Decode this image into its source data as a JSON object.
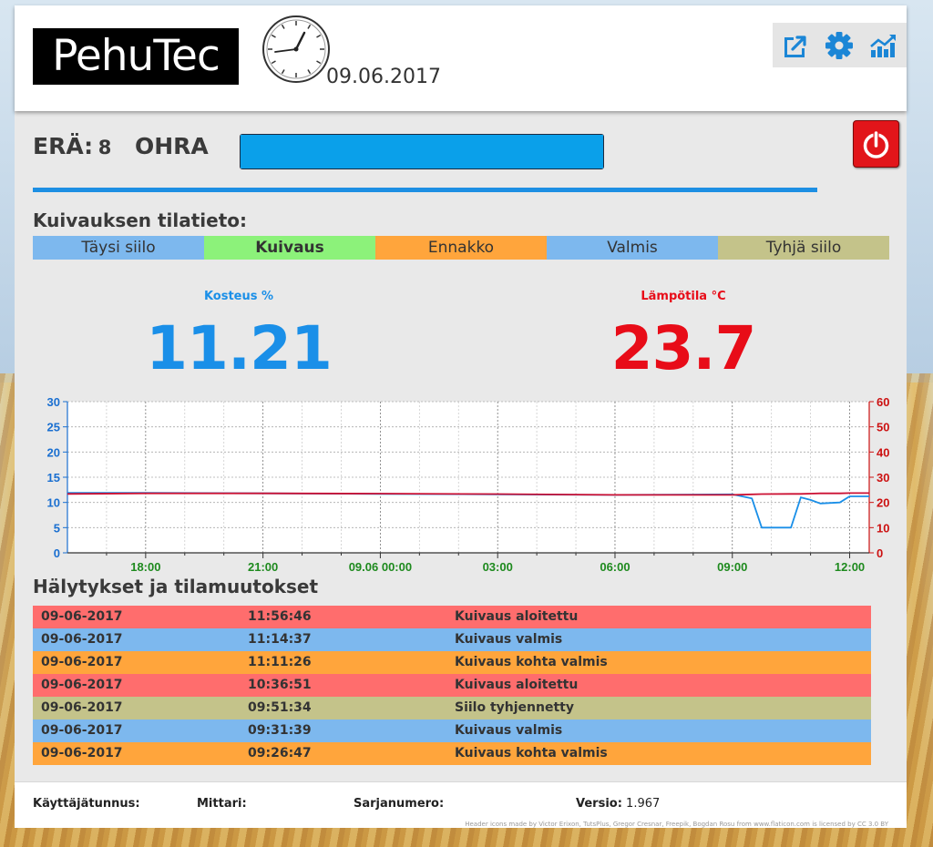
{
  "app": {
    "logo_text": "PehuTec",
    "date": "09.06.2017",
    "toolbar": {
      "icons": [
        "export-icon",
        "gear-icon",
        "chart-trend-icon"
      ]
    }
  },
  "batch": {
    "label": "ERÄ:",
    "number": "8",
    "grain": "OHRA",
    "progress_fraction": 1.0
  },
  "status": {
    "title": "Kuivauksen tilatieto:",
    "states": [
      {
        "label": "Täysi siilo",
        "color": "#7db8ee",
        "active": false
      },
      {
        "label": "Kuivaus",
        "color": "#8cf27a",
        "active": true
      },
      {
        "label": "Ennakko",
        "color": "#ffa53c",
        "active": false
      },
      {
        "label": "Valmis",
        "color": "#7db8ee",
        "active": false
      },
      {
        "label": "Tyhjä siilo",
        "color": "#c4c38a",
        "active": false
      }
    ]
  },
  "gauges": {
    "moisture": {
      "label": "Kosteus %",
      "value": "11.21",
      "color": "#1a8fe8"
    },
    "temperature": {
      "label": "Lämpötila °C",
      "value": "23.7",
      "color": "#e80c18"
    }
  },
  "chart_data": {
    "type": "line",
    "x_ticks": [
      "18:00",
      "21:00",
      "09.06 00:00",
      "03:00",
      "06:00",
      "09:00",
      "12:00"
    ],
    "x": [
      "2017-06-08 16:00",
      "2017-06-08 18:00",
      "2017-06-08 21:00",
      "2017-06-09 00:00",
      "2017-06-09 03:00",
      "2017-06-09 06:00",
      "2017-06-09 09:00",
      "2017-06-09 09:30",
      "2017-06-09 09:45",
      "2017-06-09 10:30",
      "2017-06-09 10:45",
      "2017-06-09 11:00",
      "2017-06-09 11:15",
      "2017-06-09 11:45",
      "2017-06-09 12:00",
      "2017-06-09 12:30"
    ],
    "left_axis": {
      "min": 0,
      "max": 30,
      "ticks": [
        0,
        5,
        10,
        15,
        20,
        25,
        30
      ],
      "color": "#1a6fd0"
    },
    "right_axis": {
      "min": 0,
      "max": 60,
      "ticks": [
        0,
        10,
        20,
        30,
        40,
        50,
        60
      ],
      "color": "#cc1111"
    },
    "series": [
      {
        "axis": "left",
        "color": "#1a8fe8",
        "values": [
          11.9,
          11.9,
          11.8,
          11.7,
          11.6,
          11.5,
          11.6,
          10.8,
          5.0,
          5.0,
          11.0,
          10.5,
          9.8,
          10.0,
          11.2,
          11.2
        ]
      },
      {
        "axis": "right",
        "color": "#cc1133",
        "values": [
          23.4,
          23.6,
          23.6,
          23.5,
          23.3,
          23.0,
          23.0,
          23.2,
          23.3,
          23.4,
          23.4,
          23.5,
          23.6,
          23.6,
          23.7,
          23.7
        ]
      }
    ],
    "grid": true
  },
  "alarms": {
    "title": "Hälytykset ja tilamuutokset",
    "rows": [
      {
        "date": "09-06-2017",
        "time": "11:56:46",
        "message": "Kuivaus aloitettu",
        "color": "#ff6d6d"
      },
      {
        "date": "09-06-2017",
        "time": "11:14:37",
        "message": "Kuivaus valmis",
        "color": "#7db8ee"
      },
      {
        "date": "09-06-2017",
        "time": "11:11:26",
        "message": "Kuivaus kohta valmis",
        "color": "#ffa53c"
      },
      {
        "date": "09-06-2017",
        "time": "10:36:51",
        "message": "Kuivaus aloitettu",
        "color": "#ff6d6d"
      },
      {
        "date": "09-06-2017",
        "time": "09:51:34",
        "message": "Siilo tyhjennetty",
        "color": "#c4c38a"
      },
      {
        "date": "09-06-2017",
        "time": "09:31:39",
        "message": "Kuivaus valmis",
        "color": "#7db8ee"
      },
      {
        "date": "09-06-2017",
        "time": "09:26:47",
        "message": "Kuivaus kohta valmis",
        "color": "#ffa53c"
      }
    ]
  },
  "footer": {
    "user_label": "Käyttäjätunnus:",
    "meter_label": "Mittari:",
    "serial_label": "Sarjanumero:",
    "version_label": "Versio:",
    "version_value": "1.967",
    "credit": "Header icons made by Victor Erixon, TutsPlus, Gregor Cresnar, Freepik, Bogdan Rosu from www.flaticon.com is licensed by CC 3.0 BY"
  }
}
